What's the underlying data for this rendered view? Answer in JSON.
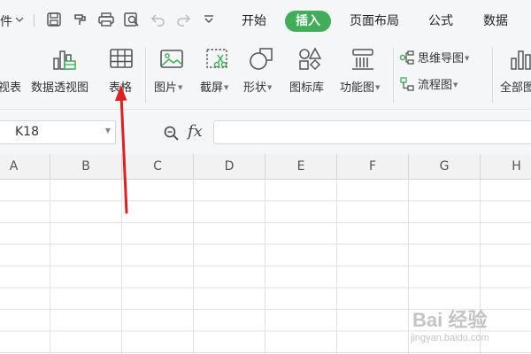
{
  "quick_access": {
    "file_menu_partial": "件",
    "icons": [
      "chevron-down-icon",
      "save-icon",
      "format-painter-icon",
      "print-icon",
      "print-preview-icon",
      "undo-icon",
      "redo-icon",
      "customize-icon"
    ]
  },
  "tabs": [
    {
      "label": "开始",
      "active": false
    },
    {
      "label": "插入",
      "active": true
    },
    {
      "label": "页面布局",
      "active": false
    },
    {
      "label": "公式",
      "active": false
    },
    {
      "label": "数据",
      "active": false
    }
  ],
  "ribbon": {
    "partial_left": "视表",
    "pivot_chart": "数据透视图",
    "table": "表格",
    "picture": "图片",
    "screenshot": "截屏",
    "shape": "形状",
    "icon_library": "图标库",
    "function_chart": "功能图",
    "mind_map": "思维导图",
    "flowchart": "流程图",
    "all_partial": "全部图"
  },
  "formula_bar": {
    "name_box": "K18",
    "fx": "fx",
    "formula": ""
  },
  "columns": [
    "A",
    "B",
    "C",
    "D",
    "E",
    "F",
    "G",
    "H"
  ],
  "watermark": {
    "line1": "Bai 经验",
    "line2": "jingyan.baidu.com"
  },
  "colors": {
    "accent": "#3fae57",
    "arrow": "#e02020"
  }
}
